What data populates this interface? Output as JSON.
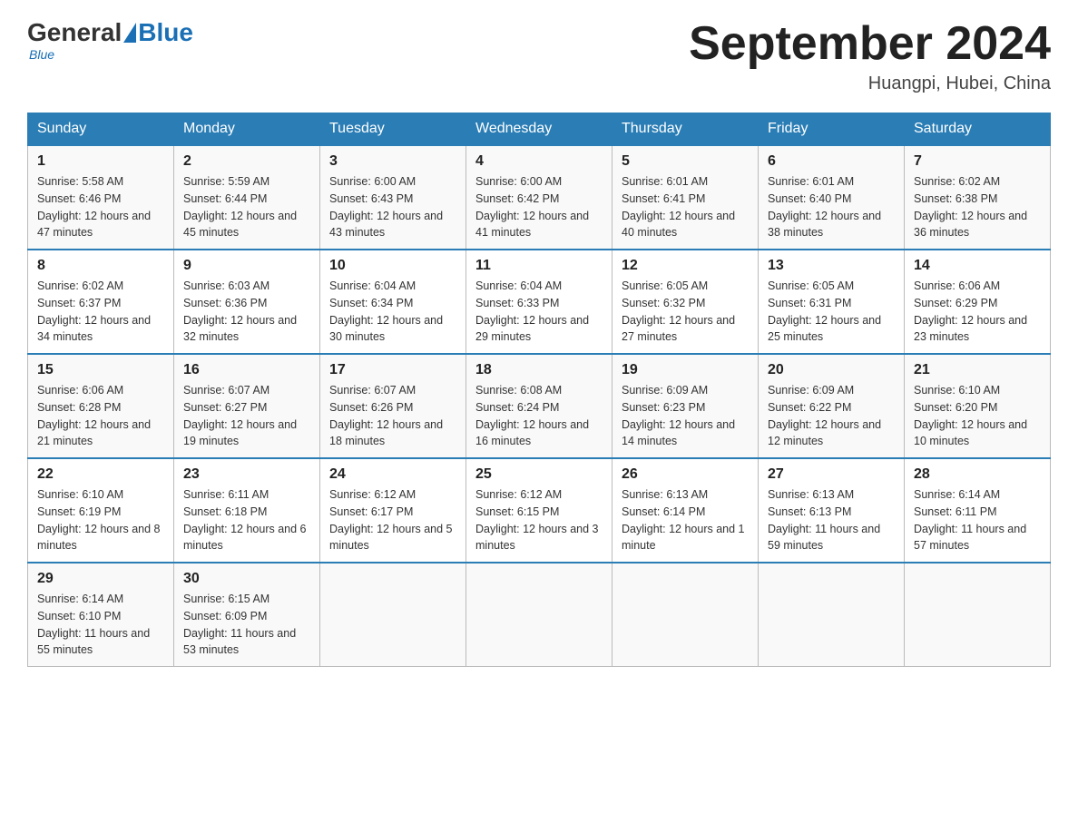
{
  "header": {
    "logo": {
      "general": "General",
      "blue": "Blue",
      "subtitle": "Blue"
    },
    "title": "September 2024",
    "location": "Huangpi, Hubei, China"
  },
  "weekdays": [
    "Sunday",
    "Monday",
    "Tuesday",
    "Wednesday",
    "Thursday",
    "Friday",
    "Saturday"
  ],
  "weeks": [
    [
      {
        "day": "1",
        "sunrise": "5:58 AM",
        "sunset": "6:46 PM",
        "daylight": "12 hours and 47 minutes."
      },
      {
        "day": "2",
        "sunrise": "5:59 AM",
        "sunset": "6:44 PM",
        "daylight": "12 hours and 45 minutes."
      },
      {
        "day": "3",
        "sunrise": "6:00 AM",
        "sunset": "6:43 PM",
        "daylight": "12 hours and 43 minutes."
      },
      {
        "day": "4",
        "sunrise": "6:00 AM",
        "sunset": "6:42 PM",
        "daylight": "12 hours and 41 minutes."
      },
      {
        "day": "5",
        "sunrise": "6:01 AM",
        "sunset": "6:41 PM",
        "daylight": "12 hours and 40 minutes."
      },
      {
        "day": "6",
        "sunrise": "6:01 AM",
        "sunset": "6:40 PM",
        "daylight": "12 hours and 38 minutes."
      },
      {
        "day": "7",
        "sunrise": "6:02 AM",
        "sunset": "6:38 PM",
        "daylight": "12 hours and 36 minutes."
      }
    ],
    [
      {
        "day": "8",
        "sunrise": "6:02 AM",
        "sunset": "6:37 PM",
        "daylight": "12 hours and 34 minutes."
      },
      {
        "day": "9",
        "sunrise": "6:03 AM",
        "sunset": "6:36 PM",
        "daylight": "12 hours and 32 minutes."
      },
      {
        "day": "10",
        "sunrise": "6:04 AM",
        "sunset": "6:34 PM",
        "daylight": "12 hours and 30 minutes."
      },
      {
        "day": "11",
        "sunrise": "6:04 AM",
        "sunset": "6:33 PM",
        "daylight": "12 hours and 29 minutes."
      },
      {
        "day": "12",
        "sunrise": "6:05 AM",
        "sunset": "6:32 PM",
        "daylight": "12 hours and 27 minutes."
      },
      {
        "day": "13",
        "sunrise": "6:05 AM",
        "sunset": "6:31 PM",
        "daylight": "12 hours and 25 minutes."
      },
      {
        "day": "14",
        "sunrise": "6:06 AM",
        "sunset": "6:29 PM",
        "daylight": "12 hours and 23 minutes."
      }
    ],
    [
      {
        "day": "15",
        "sunrise": "6:06 AM",
        "sunset": "6:28 PM",
        "daylight": "12 hours and 21 minutes."
      },
      {
        "day": "16",
        "sunrise": "6:07 AM",
        "sunset": "6:27 PM",
        "daylight": "12 hours and 19 minutes."
      },
      {
        "day": "17",
        "sunrise": "6:07 AM",
        "sunset": "6:26 PM",
        "daylight": "12 hours and 18 minutes."
      },
      {
        "day": "18",
        "sunrise": "6:08 AM",
        "sunset": "6:24 PM",
        "daylight": "12 hours and 16 minutes."
      },
      {
        "day": "19",
        "sunrise": "6:09 AM",
        "sunset": "6:23 PM",
        "daylight": "12 hours and 14 minutes."
      },
      {
        "day": "20",
        "sunrise": "6:09 AM",
        "sunset": "6:22 PM",
        "daylight": "12 hours and 12 minutes."
      },
      {
        "day": "21",
        "sunrise": "6:10 AM",
        "sunset": "6:20 PM",
        "daylight": "12 hours and 10 minutes."
      }
    ],
    [
      {
        "day": "22",
        "sunrise": "6:10 AM",
        "sunset": "6:19 PM",
        "daylight": "12 hours and 8 minutes."
      },
      {
        "day": "23",
        "sunrise": "6:11 AM",
        "sunset": "6:18 PM",
        "daylight": "12 hours and 6 minutes."
      },
      {
        "day": "24",
        "sunrise": "6:12 AM",
        "sunset": "6:17 PM",
        "daylight": "12 hours and 5 minutes."
      },
      {
        "day": "25",
        "sunrise": "6:12 AM",
        "sunset": "6:15 PM",
        "daylight": "12 hours and 3 minutes."
      },
      {
        "day": "26",
        "sunrise": "6:13 AM",
        "sunset": "6:14 PM",
        "daylight": "12 hours and 1 minute."
      },
      {
        "day": "27",
        "sunrise": "6:13 AM",
        "sunset": "6:13 PM",
        "daylight": "11 hours and 59 minutes."
      },
      {
        "day": "28",
        "sunrise": "6:14 AM",
        "sunset": "6:11 PM",
        "daylight": "11 hours and 57 minutes."
      }
    ],
    [
      {
        "day": "29",
        "sunrise": "6:14 AM",
        "sunset": "6:10 PM",
        "daylight": "11 hours and 55 minutes."
      },
      {
        "day": "30",
        "sunrise": "6:15 AM",
        "sunset": "6:09 PM",
        "daylight": "11 hours and 53 minutes."
      },
      null,
      null,
      null,
      null,
      null
    ]
  ],
  "labels": {
    "sunrise": "Sunrise:",
    "sunset": "Sunset:",
    "daylight": "Daylight:"
  }
}
